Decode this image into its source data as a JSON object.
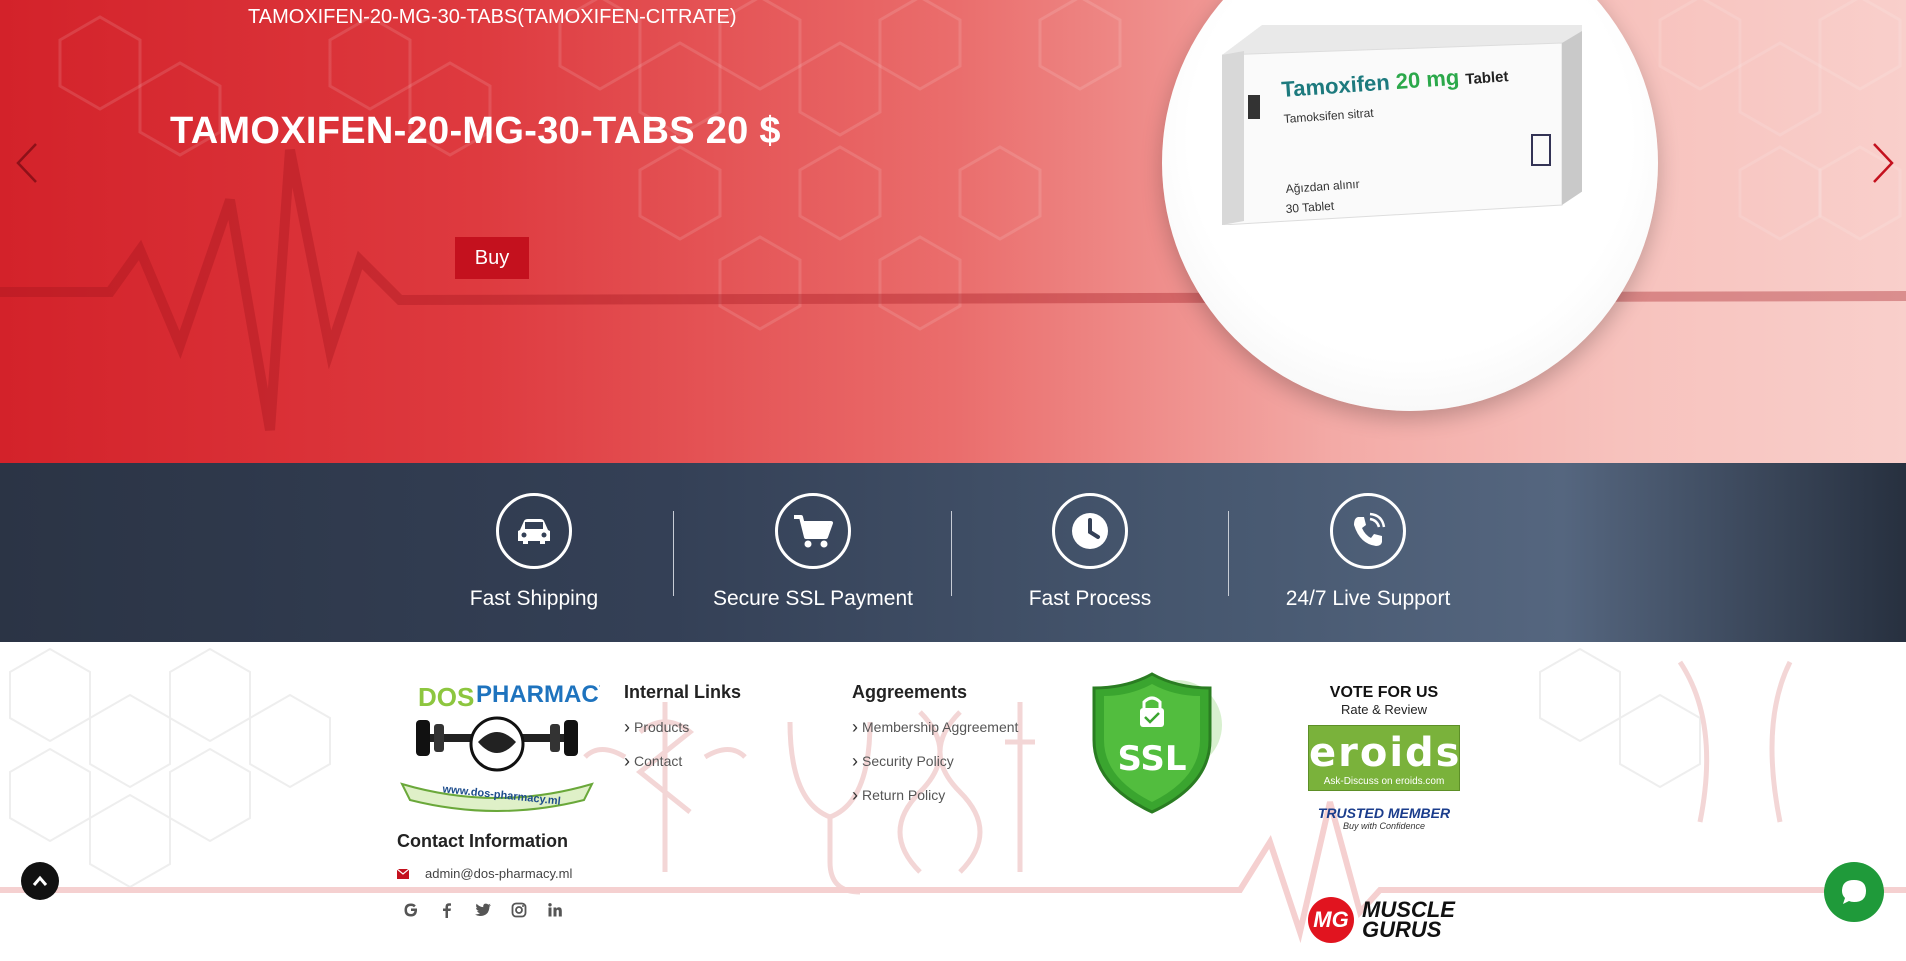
{
  "hero": {
    "top_title": "TAMOXIFEN-20-MG-30-TABS(TAMOXIFEN-CITRATE)",
    "heading": "TAMOXIFEN-20-MG-30-TABS 20 $",
    "buy_label": "Buy",
    "product_box": {
      "brand": "Tamoxifen",
      "dose": "20 mg",
      "form": "Tablet",
      "subtitle": "Tamoksifen sitrat",
      "note": "Ağızdan alınır",
      "count": "30 Tablet"
    },
    "prev_icon": "chevron-left-icon",
    "next_icon": "chevron-right-icon"
  },
  "features": [
    {
      "label": "Fast Shipping",
      "icon": "car-icon"
    },
    {
      "label": "Secure SSL Payment",
      "icon": "cart-icon"
    },
    {
      "label": "Fast Process",
      "icon": "clock-icon"
    },
    {
      "label": "24/7 Live Support",
      "icon": "phone-icon"
    }
  ],
  "footer": {
    "logo": {
      "dos": "DOS",
      "pharmacy": "PHARMACY",
      "url": "www.dos-pharmacy.ml"
    },
    "contact_title": "Contact Information",
    "email": "admin@dos-pharmacy.ml",
    "social": [
      "google-icon",
      "facebook-icon",
      "twitter-icon",
      "instagram-icon",
      "linkedin-icon"
    ],
    "internal_links": {
      "title": "Internal Links",
      "items": [
        "Products",
        "Contact"
      ]
    },
    "agreements": {
      "title": "Aggreements",
      "items": [
        "Membership Aggreement",
        "Security Policy",
        "Return Policy"
      ]
    },
    "ssl_label": "SSL",
    "vote": {
      "title": "VOTE FOR US",
      "subtitle": "Rate & Review",
      "eroids": "eroids",
      "eroids_sub": "Ask-Discuss on eroids.com",
      "trusted": "TRUSTED MEMBER",
      "trusted_sub": "Buy with Confidence"
    },
    "muscle_gurus": {
      "mark": "MG",
      "line1": "MUSCLE",
      "line2": "GURUS"
    }
  },
  "colors": {
    "hero_red": "#d3222a",
    "buy_red": "#c4111e",
    "features_bg": "#344056",
    "chat_green": "#1f9a3a",
    "ssl_green": "#3aa52f"
  }
}
